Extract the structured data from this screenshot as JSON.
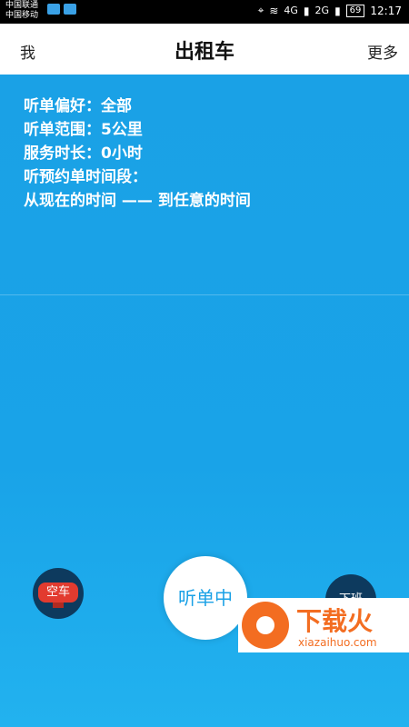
{
  "status_bar": {
    "carrier_1": "中国联通",
    "carrier_2": "中国移动",
    "signal_1": "4G",
    "signal_2": "2G",
    "battery": "69",
    "time": "12:17"
  },
  "nav": {
    "left": "我",
    "title": "出租车",
    "right": "更多"
  },
  "info": {
    "line1": "听单偏好：全部",
    "line2": "听单范围：5公里",
    "line3": "服务时长：0小时",
    "line4": "听预约单时间段：",
    "line5": "从现在的时间 —— 到任意的时间"
  },
  "buttons": {
    "empty_car": "空车",
    "listening": "听单中",
    "off_work": "下班"
  },
  "watermark": {
    "title": "下载火",
    "sub": "xiazaihuo.com"
  },
  "colors": {
    "primary_blue": "#1aa1e6",
    "dark_button": "#0d3a5e",
    "red_badge": "#e23b2f",
    "watermark_orange": "#f36d21"
  }
}
